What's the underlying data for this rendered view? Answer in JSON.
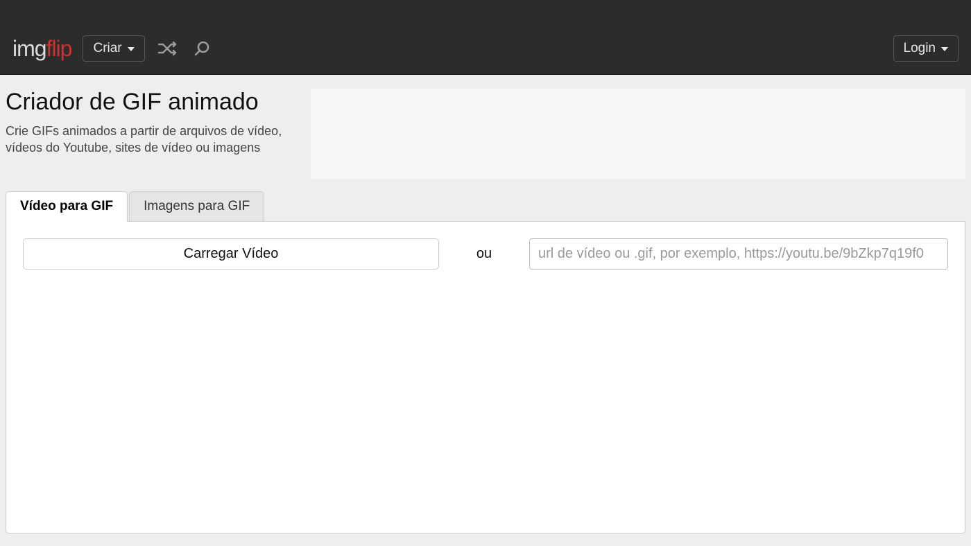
{
  "header": {
    "logo_part1": "img",
    "logo_part2": "flip",
    "create_label": "Criar",
    "login_label": "Login"
  },
  "heading": {
    "title": "Criador de GIF animado",
    "subtitle": "Crie GIFs animados a partir de arquivos de vídeo, vídeos do Youtube, sites de vídeo ou imagens"
  },
  "tabs": {
    "video": "Vídeo para GIF",
    "images": "Imagens para GIF"
  },
  "panel": {
    "upload_label": "Carregar Vídeo",
    "or_label": "ou",
    "url_placeholder": "url de vídeo ou .gif, por exemplo, https://youtu.be/9bZkp7q19f0"
  }
}
